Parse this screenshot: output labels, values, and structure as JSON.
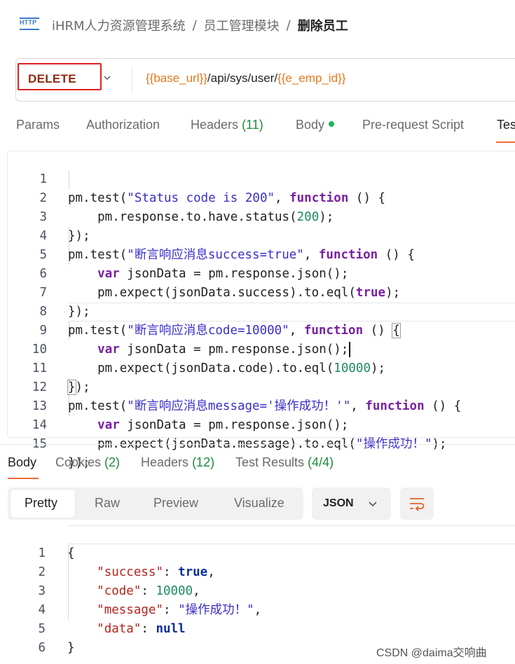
{
  "breadcrumb": {
    "part1": "iHRM人力资源管理系统",
    "part2": "员工管理模块",
    "current": "删除员工",
    "separator": "/",
    "icon_text": "HTTP"
  },
  "request": {
    "method": "DELETE",
    "url_var1": "{{base_url}}",
    "url_mid": "/api/sys/user/",
    "url_var2": "{{e_emp_id}}"
  },
  "request_tabs": {
    "params": "Params",
    "authorization": "Authorization",
    "headers_label": "Headers",
    "headers_count": "(11)",
    "body": "Body",
    "prerequest": "Pre-request Script",
    "tests": "Tes"
  },
  "test_script": [
    {
      "n": "1",
      "t": "pm.test(\"Status code is 200\", function () {"
    },
    {
      "n": "2",
      "t": "    pm.response.to.have.status(200);"
    },
    {
      "n": "3",
      "t": "});"
    },
    {
      "n": "4",
      "t": "pm.test(\"断言响应消息success=true\", function () {"
    },
    {
      "n": "5",
      "t": "    var jsonData = pm.response.json();"
    },
    {
      "n": "6",
      "t": "    pm.expect(jsonData.success).to.eql(true);"
    },
    {
      "n": "7",
      "t": "});"
    },
    {
      "n": "8",
      "t": "pm.test(\"断言响应消息code=10000\", function () {"
    },
    {
      "n": "9",
      "t": "    var jsonData = pm.response.json();"
    },
    {
      "n": "10",
      "t": "    pm.expect(jsonData.code).to.eql(10000);"
    },
    {
      "n": "11",
      "t": "});"
    },
    {
      "n": "12",
      "t": "pm.test(\"断言响应消息message='操作成功！'\", function () {"
    },
    {
      "n": "13",
      "t": "    var jsonData = pm.response.json();"
    },
    {
      "n": "14",
      "t": "    pm.expect(jsonData.message).to.eql(\"操作成功！\");"
    },
    {
      "n": "15",
      "t": "});"
    }
  ],
  "response_tabs": {
    "body": "Body",
    "cookies_label": "Cookies",
    "cookies_count": "(2)",
    "headers_label": "Headers",
    "headers_count": "(12)",
    "results_label": "Test Results",
    "results_count": "(4/4)"
  },
  "view_modes": {
    "pretty": "Pretty",
    "raw": "Raw",
    "preview": "Preview",
    "visualize": "Visualize"
  },
  "format": "JSON",
  "response_body": [
    {
      "n": "1",
      "t": "{"
    },
    {
      "n": "2",
      "t": "    \"success\": true,"
    },
    {
      "n": "3",
      "t": "    \"code\": 10000,"
    },
    {
      "n": "4",
      "t": "    \"message\": \"操作成功！\","
    },
    {
      "n": "5",
      "t": "    \"data\": null"
    },
    {
      "n": "6",
      "t": "}"
    }
  ],
  "watermark": "CSDN @daima交响曲",
  "colors": {
    "accent": "#f26b3a",
    "method_border": "#e02020",
    "variable": "#e8761a",
    "keyword": "#7a1fa2",
    "string": "#3a2fc9",
    "number": "#1d8b5f",
    "count": "#1d8b3e"
  }
}
